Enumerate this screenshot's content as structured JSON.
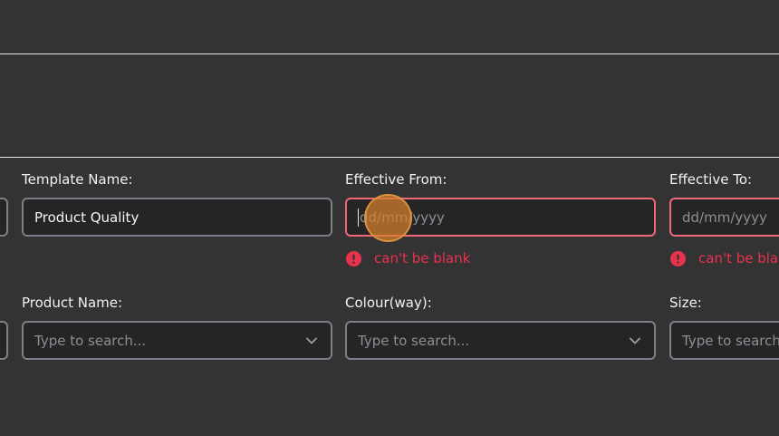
{
  "form": {
    "template_name": {
      "label": "Template Name:",
      "value": "Product Quality"
    },
    "effective_from": {
      "label": "Effective From:",
      "placeholder": "dd/mm/yyyy",
      "error": "can't be blank"
    },
    "effective_to": {
      "label": "Effective To:",
      "placeholder": "dd/mm/yyyy",
      "error": "can't be blank"
    },
    "product_name": {
      "label": "Product Name:",
      "placeholder": "Type to search..."
    },
    "colourway": {
      "label": "Colour(way):",
      "placeholder": "Type to search..."
    },
    "size": {
      "label": "Size:",
      "placeholder": "Type to search..."
    }
  },
  "colors": {
    "background": "#333333",
    "field_border": "#7a808a",
    "error_border": "#f0687a",
    "error_text": "#e8334f",
    "click_indicator": "#d6802d"
  },
  "icons": [
    "chevron-down-icon",
    "error-icon"
  ]
}
